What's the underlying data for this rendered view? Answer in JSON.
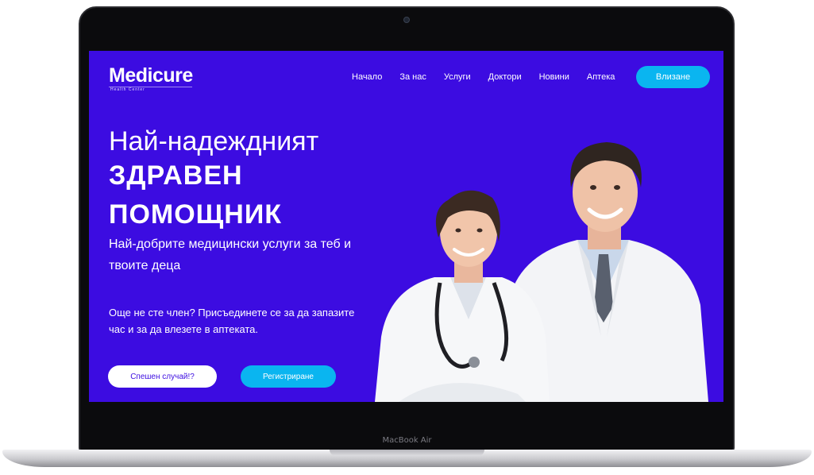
{
  "device": {
    "label": "MacBook Air"
  },
  "site": {
    "logo": {
      "name": "Medicure",
      "tagline": "Health Center"
    },
    "nav": [
      {
        "label": "Начало"
      },
      {
        "label": "За нас"
      },
      {
        "label": "Услуги"
      },
      {
        "label": "Доктори"
      },
      {
        "label": "Новини"
      },
      {
        "label": "Аптека"
      }
    ],
    "login_label": "Влизане",
    "hero": {
      "title_line": "Най-надеждният",
      "bold_line1": "ЗДРАВЕН",
      "bold_line2": "ПОМОЩНИК",
      "subtitle": "Най-добрите медицински услуги за теб и твоите деца",
      "note": "Още не сте член? Присъединете се за да запазите час и за да влезете в аптеката.",
      "emergency_label": "Спешен случай!?",
      "register_label": "Регистриране"
    }
  },
  "colors": {
    "primary_bg": "#3c0ce1",
    "accent": "#0ab5f0",
    "text": "#ffffff"
  },
  "icons": [
    "camera-icon",
    "doctors-photo"
  ]
}
